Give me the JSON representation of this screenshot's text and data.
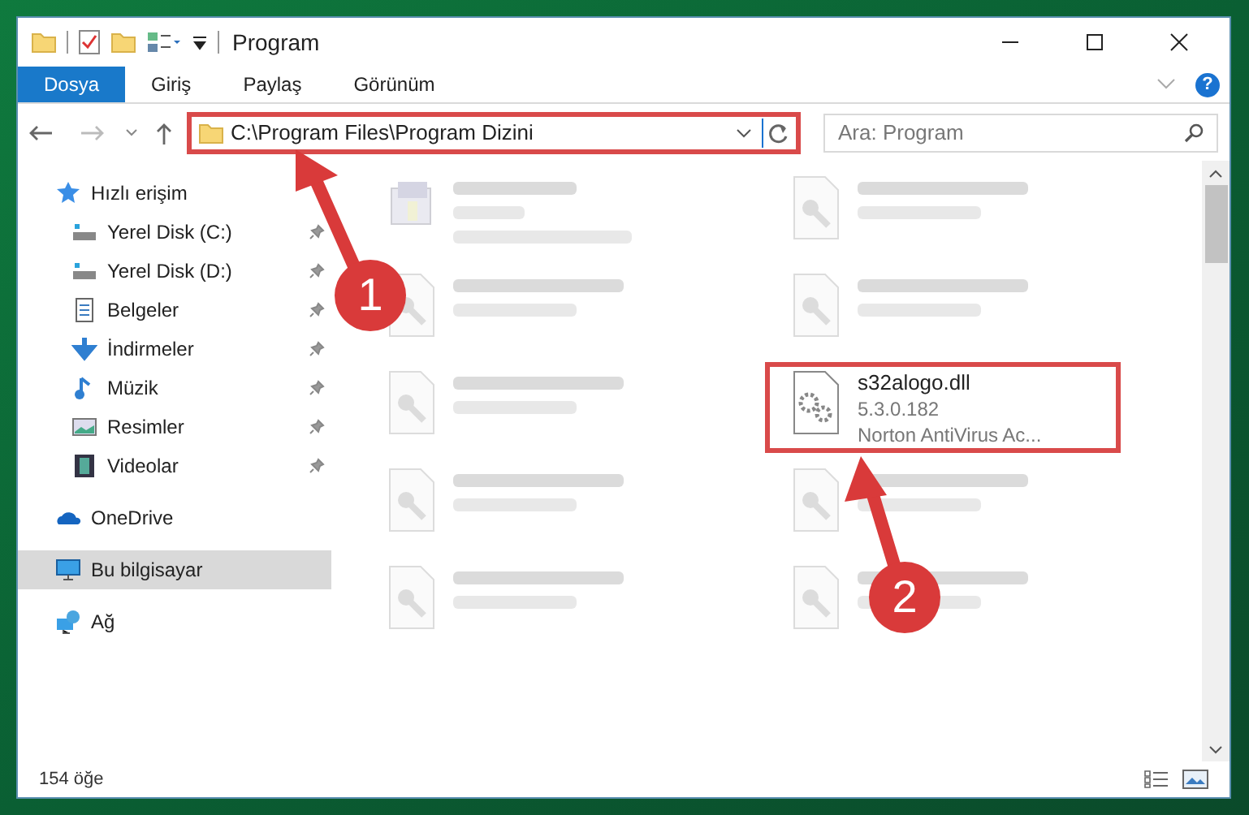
{
  "window": {
    "title": "Program"
  },
  "ribbon": {
    "tabs": [
      {
        "label": "Dosya",
        "selected": true
      },
      {
        "label": "Giriş",
        "selected": false
      },
      {
        "label": "Paylaş",
        "selected": false
      },
      {
        "label": "Görünüm",
        "selected": false
      }
    ],
    "help": "?"
  },
  "address": {
    "path": "C:\\Program Files\\Program Dizini",
    "highlighted": true
  },
  "search": {
    "placeholder": "Ara: Program"
  },
  "sidebar": {
    "items": [
      {
        "label": "Hızlı erişim",
        "selected": false,
        "children": [
          {
            "label": "Yerel Disk (C:)",
            "pinned": true,
            "selected": false
          },
          {
            "label": "Yerel Disk (D:)",
            "pinned": true,
            "selected": false
          },
          {
            "label": "Belgeler",
            "pinned": true,
            "selected": false
          },
          {
            "label": "İndirmeler",
            "pinned": true,
            "selected": false
          },
          {
            "label": "Müzik",
            "pinned": true,
            "selected": false
          },
          {
            "label": "Resimler",
            "pinned": true,
            "selected": false
          },
          {
            "label": "Videolar",
            "pinned": true,
            "selected": false
          }
        ]
      },
      {
        "label": "OneDrive",
        "selected": false
      },
      {
        "label": "Bu bilgisayar",
        "selected": true
      },
      {
        "label": "Ağ",
        "selected": false
      }
    ]
  },
  "files": [
    {
      "kind": "exe",
      "blurred": true
    },
    {
      "kind": "dll",
      "blurred": true
    },
    {
      "kind": "dll",
      "blurred": true
    },
    {
      "kind": "dll",
      "blurred": true
    },
    {
      "kind": "dll",
      "blurred": true
    },
    {
      "name": "s32alogo.dll",
      "lines": [
        "5.3.0.182",
        "Norton AntiVirus Ac..."
      ],
      "kind": "gear",
      "blurred": false,
      "highlighted": true
    },
    {
      "kind": "dll",
      "blurred": true
    },
    {
      "kind": "dll",
      "blurred": true
    },
    {
      "kind": "dll",
      "blurred": true
    },
    {
      "kind": "dll",
      "blurred": true
    }
  ],
  "status_bar": {
    "count": "154 öğe"
  },
  "annotations": [
    {
      "label": "1"
    },
    {
      "label": "2"
    }
  ]
}
